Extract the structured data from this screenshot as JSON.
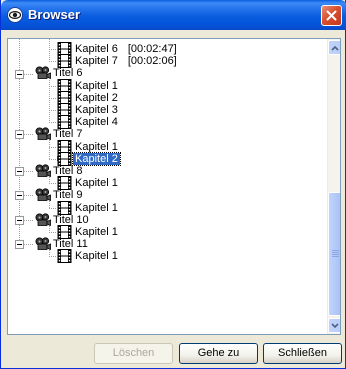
{
  "window": {
    "title": "Browser"
  },
  "tree": {
    "rows": [
      {
        "kind": "chapter",
        "label": "Kapitel 6",
        "time": "[00:02:47]"
      },
      {
        "kind": "chapter",
        "label": "Kapitel 7",
        "time": "[00:02:06]"
      },
      {
        "kind": "title",
        "label": "Titel 6"
      },
      {
        "kind": "chapter",
        "label": "Kapitel 1"
      },
      {
        "kind": "chapter",
        "label": "Kapitel 2"
      },
      {
        "kind": "chapter",
        "label": "Kapitel 3"
      },
      {
        "kind": "chapter",
        "label": "Kapitel 4"
      },
      {
        "kind": "title",
        "label": "Titel 7"
      },
      {
        "kind": "chapter",
        "label": "Kapitel 1"
      },
      {
        "kind": "chapter",
        "label": "Kapitel 2",
        "selected": true
      },
      {
        "kind": "title",
        "label": "Titel 8"
      },
      {
        "kind": "chapter",
        "label": "Kapitel 1"
      },
      {
        "kind": "title",
        "label": "Titel 9"
      },
      {
        "kind": "chapter",
        "label": "Kapitel 1"
      },
      {
        "kind": "title",
        "label": "Titel 10"
      },
      {
        "kind": "chapter",
        "label": "Kapitel 1"
      },
      {
        "kind": "title",
        "label": "Titel 11"
      },
      {
        "kind": "chapter",
        "label": "Kapitel 1"
      }
    ]
  },
  "buttons": {
    "delete": "Löschen",
    "goto": "Gehe zu",
    "close": "Schließen"
  },
  "colors": {
    "titlebar": "#0a5ddf",
    "selection": "#316ac5",
    "close": "#d9502f"
  }
}
